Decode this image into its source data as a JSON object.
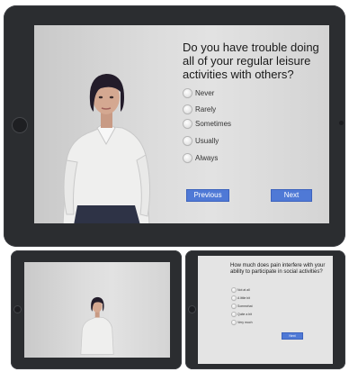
{
  "main": {
    "question": "Do you have trouble doing all of your regular leisure activities with others?",
    "options": [
      "Never",
      "Rarely",
      "Sometimes",
      "Usually",
      "Always"
    ],
    "previous_label": "Previous",
    "next_label": "Next"
  },
  "thumbnail_right": {
    "question": "How much does pain interfere with your ability to participate in social activities?",
    "options": [
      "Not at all",
      "A little bit",
      "Somewhat",
      "Quite a bit",
      "Very much"
    ],
    "next_label": "Next"
  },
  "colors": {
    "bezel": "#2b2d30",
    "screen_bg": "#dcdcdc",
    "button": "#4f79d6"
  }
}
